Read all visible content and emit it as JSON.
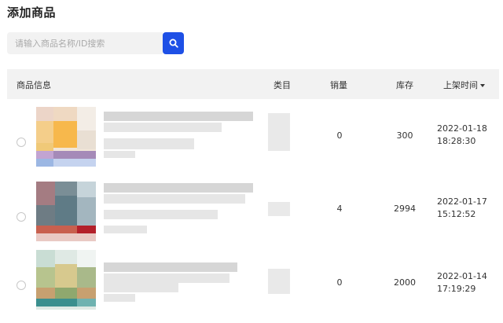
{
  "page": {
    "title": "添加商品"
  },
  "search": {
    "placeholder": "请输入商品名称/ID搜索",
    "button_icon": "search-icon"
  },
  "table": {
    "columns": {
      "info": "商品信息",
      "category": "类目",
      "sales": "销量",
      "stock": "库存",
      "listed_time": "上架时间"
    },
    "sort_indicator": "caret-down-icon",
    "rows": [
      {
        "sales": "0",
        "stock": "300",
        "date": "2022-01-18",
        "time": "18:28:30"
      },
      {
        "sales": "4",
        "stock": "2994",
        "date": "2022-01-17",
        "time": "15:12:52"
      },
      {
        "sales": "0",
        "stock": "2000",
        "date": "2022-01-14",
        "time": "17:19:29"
      }
    ]
  },
  "colors": {
    "accent": "#1e50e6",
    "header_bg": "#f2f2f2"
  }
}
